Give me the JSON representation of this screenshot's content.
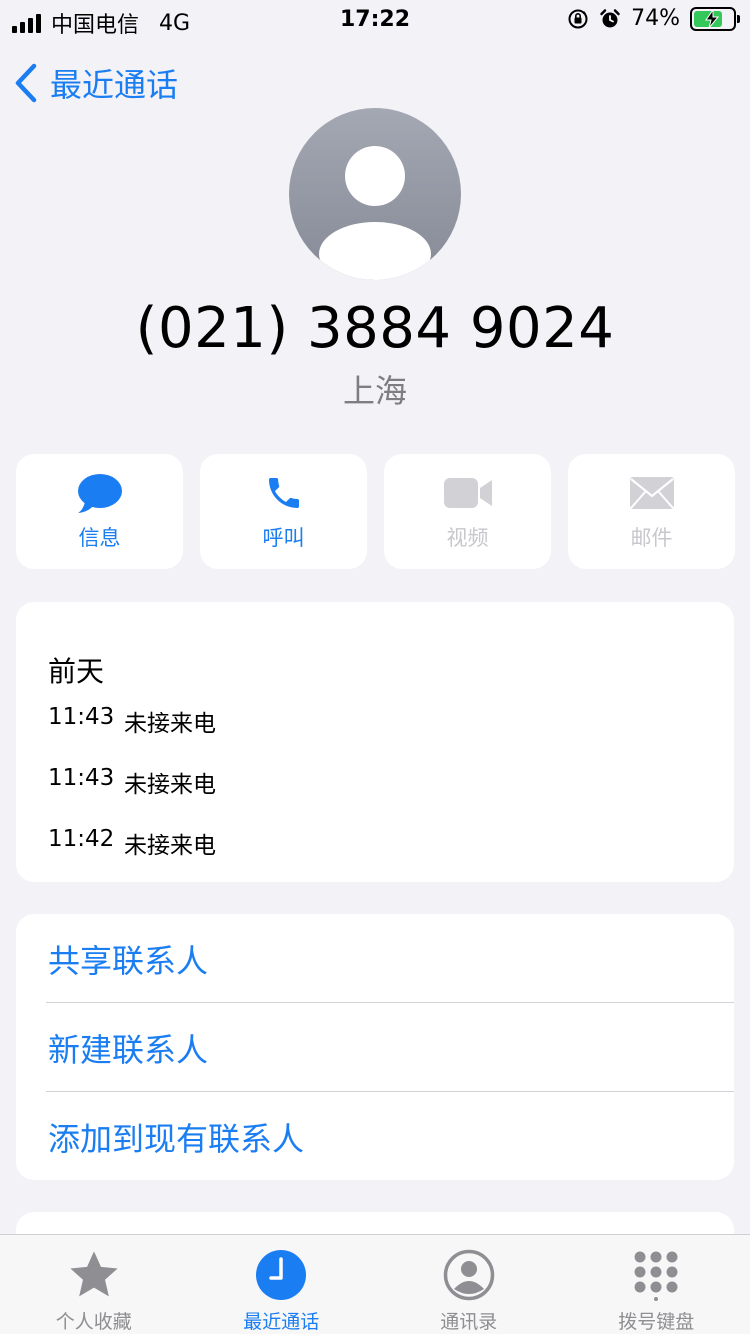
{
  "status_bar": {
    "carrier": "中国电信",
    "network": "4G",
    "time": "17:22",
    "battery_percent": "74%",
    "battery_level": 0.74
  },
  "nav": {
    "back_label": "最近通话"
  },
  "contact": {
    "phone_number": "(021) 3884 9024",
    "location": "上海"
  },
  "actions": [
    {
      "label": "信息",
      "icon": "message-icon",
      "enabled": true
    },
    {
      "label": "呼叫",
      "icon": "phone-icon",
      "enabled": true
    },
    {
      "label": "视频",
      "icon": "video-icon",
      "enabled": false
    },
    {
      "label": "邮件",
      "icon": "mail-icon",
      "enabled": false
    }
  ],
  "calls": {
    "date_label": "前天",
    "entries": [
      {
        "time": "11:43",
        "type": "未接来电"
      },
      {
        "time": "11:43",
        "type": "未接来电"
      },
      {
        "time": "11:42",
        "type": "未接来电"
      }
    ]
  },
  "options": [
    {
      "label": "共享联系人"
    },
    {
      "label": "新建联系人"
    },
    {
      "label": "添加到现有联系人"
    }
  ],
  "tabs": [
    {
      "label": "个人收藏",
      "icon": "star-icon",
      "active": false
    },
    {
      "label": "最近通话",
      "icon": "clock-icon",
      "active": true
    },
    {
      "label": "通讯录",
      "icon": "contacts-icon",
      "active": false
    },
    {
      "label": "拨号键盘",
      "icon": "keypad-icon",
      "active": false
    }
  ],
  "colors": {
    "accent": "#1a7df1",
    "background": "#f2f2f7",
    "disabled": "#c7c7cc",
    "secondary_text": "#7d7d83",
    "battery_fill": "#34c759"
  }
}
